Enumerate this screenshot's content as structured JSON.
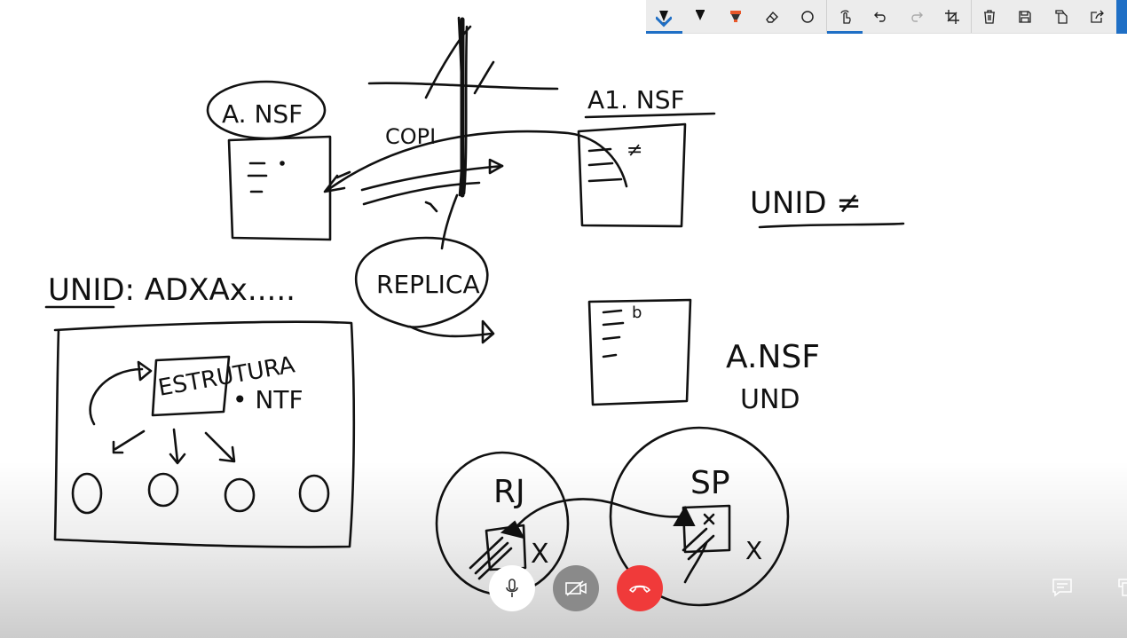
{
  "toolbar": {
    "items": [
      {
        "name": "ballpoint-pen-icon",
        "active": true,
        "color": "#111111"
      },
      {
        "name": "pencil-icon",
        "active": false,
        "color": "#111111"
      },
      {
        "name": "highlighter-icon",
        "active": false,
        "color": "#e8572a"
      },
      {
        "name": "eraser-icon",
        "active": false
      },
      {
        "name": "lasso-select-icon",
        "active": false
      },
      {
        "name": "touch-writing-icon",
        "active": true
      },
      {
        "name": "undo-icon",
        "active": false
      },
      {
        "name": "redo-icon",
        "active": false
      },
      {
        "name": "crop-icon",
        "active": false
      },
      {
        "name": "delete-icon",
        "active": false
      },
      {
        "name": "save-icon",
        "active": false
      },
      {
        "name": "copy-icon",
        "active": false
      },
      {
        "name": "share-icon",
        "active": false
      }
    ],
    "accent_color": "#1f6fc5"
  },
  "sketch": {
    "labels": {
      "a_nsf_top": "A. NSF",
      "a1_nsf": "A1. NSF",
      "copi": "COPI",
      "unid_neq": "UNID ≠",
      "replica": "REPLICA",
      "unid_adx": "UNID: ADXAx.....",
      "estrutura": "ESTRUTURA",
      "ntf": "• NTF",
      "a_nsf_bottom": "A.NSF",
      "und": "UND",
      "rj": "RJ",
      "sp": "SP",
      "doc_mark_neq": "≠",
      "doc_mark_b": "b",
      "x_mark": "X"
    }
  },
  "call_controls": {
    "mic": {
      "name": "microphone-icon",
      "bg": "#ffffff"
    },
    "camera": {
      "name": "camera-off-icon",
      "bg": "#8a8a8a"
    },
    "end_call": {
      "name": "end-call-icon",
      "bg": "#f03a3a"
    },
    "chat": {
      "name": "chat-icon"
    },
    "share": {
      "name": "share-screen-icon"
    }
  }
}
